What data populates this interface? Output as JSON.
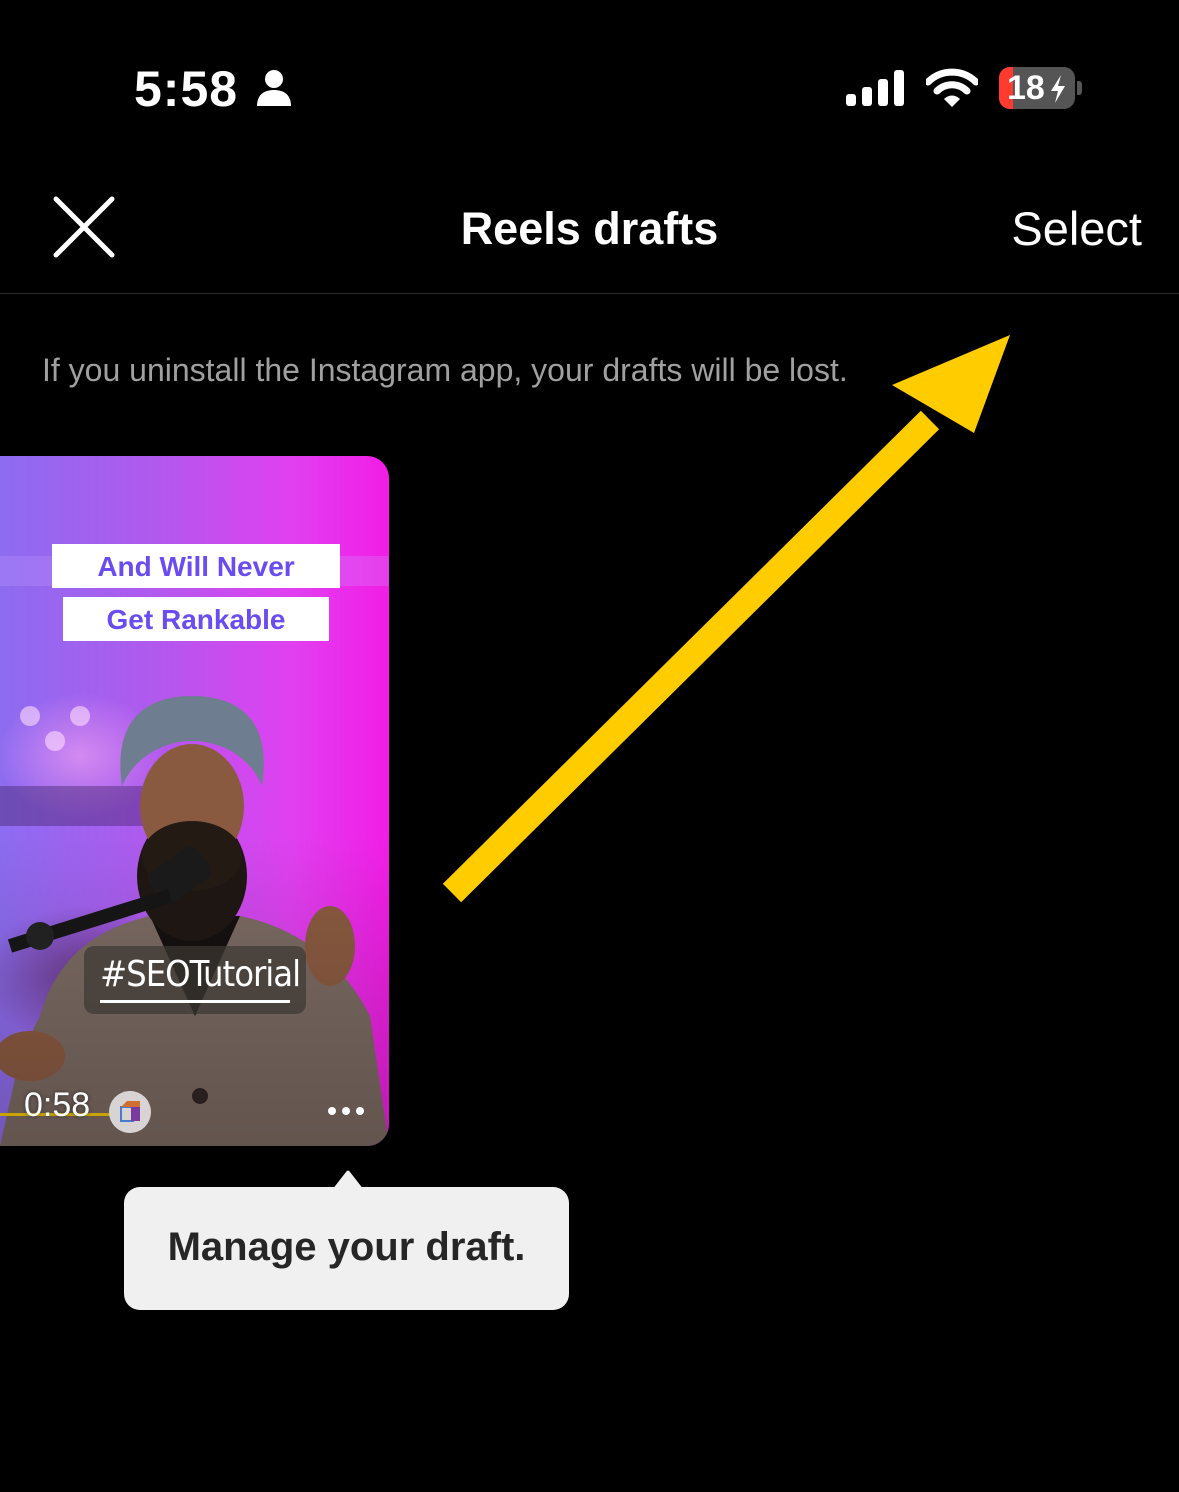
{
  "status_bar": {
    "time": "5:58",
    "battery_level": "18",
    "battery_fraction": 0.18,
    "battery_charging": true,
    "icons": [
      "person-icon",
      "signal-icon",
      "wifi-icon",
      "battery-icon",
      "bolt-icon"
    ]
  },
  "header": {
    "title": "Reels drafts",
    "close_icon": "close-icon",
    "select_label": "Select"
  },
  "info_text": "If you uninstall the Instagram app, your drafts will be lost.",
  "drafts": [
    {
      "caption_lines": [
        "And Will Never",
        "Get Rankable"
      ],
      "hashtag": "#SEOTutorial",
      "duration": "0:58",
      "more_icon": "more-horizontal-icon",
      "app_badge_icon": "app-badge-icon"
    }
  ],
  "tooltip": {
    "text": "Manage your draft."
  },
  "annotation": {
    "type": "arrow",
    "color": "#FFCC00",
    "points_to": "select-button"
  },
  "colors": {
    "background": "#000000",
    "info_text": "#A0A0A0",
    "caption_text": "#6A4CF0",
    "tooltip_bg": "#F0F0F0",
    "battery_low": "#FF3B30"
  }
}
